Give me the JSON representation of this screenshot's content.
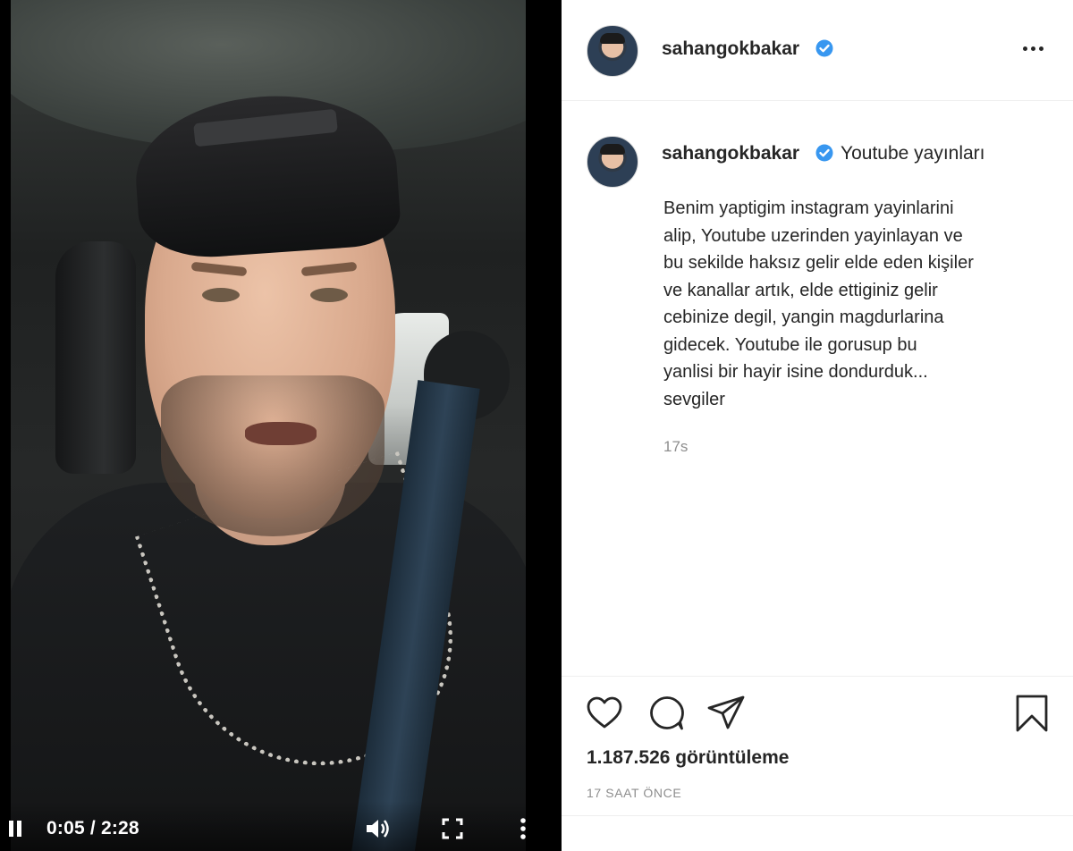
{
  "video": {
    "current_time": "0:05",
    "duration": "2:28",
    "time_separator": " / "
  },
  "header": {
    "username": "sahangokbakar",
    "verified": true,
    "more_icon": "more-horizontal-icon"
  },
  "post": {
    "username": "sahangokbakar",
    "title": "Youtube yayınları",
    "caption_lines": [
      "Benim yaptigim instagram yayinlarini",
      "alip, Youtube uzerinden yayinlayan ve",
      "bu sekilde haksız gelir elde eden kişiler",
      "ve kanallar artık, elde ettiginiz gelir",
      "cebinize degil, yangin magdurlarina",
      "gidecek. Youtube ile gorusup bu",
      "yanlisi bir hayir isine dondurduk...",
      "sevgiler"
    ],
    "relative_time": "17s"
  },
  "footer": {
    "views": "1.187.526 görüntüleme",
    "date": "17 SAAT ÖNCE"
  },
  "colors": {
    "verified_badge": "#3897f0",
    "text_primary": "#262626",
    "text_secondary": "#8e8e8e",
    "divider": "#efefef"
  }
}
